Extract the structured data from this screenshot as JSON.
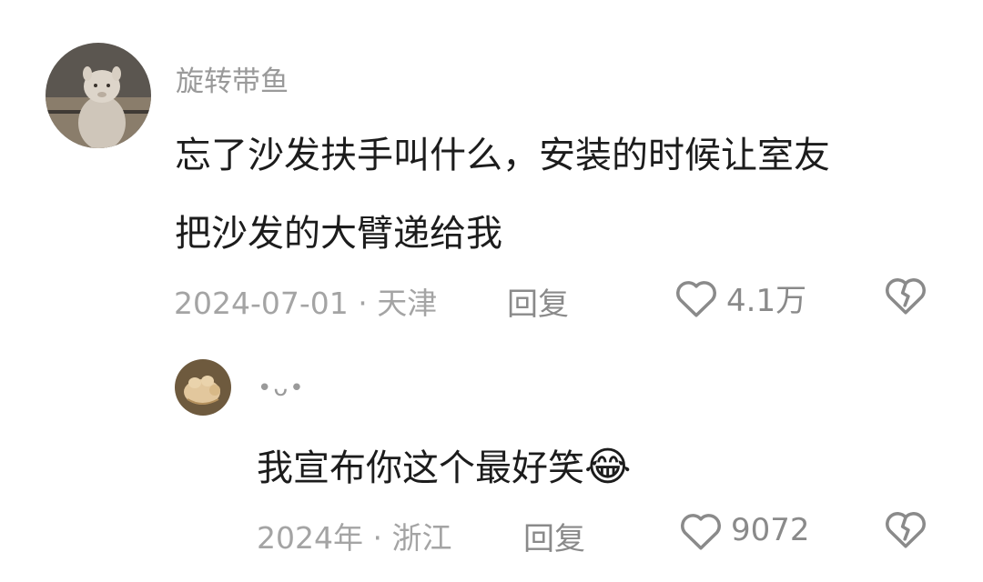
{
  "comment": {
    "username": "旋转带鱼",
    "text_line1": "忘了沙发扶手叫什么，安装的时候让室友",
    "text_line2": "把沙发的大臂递给我",
    "meta": "2024-07-01 · 天津",
    "reply_label": "回复",
    "like_count": "4.1万"
  },
  "reply": {
    "username": "•ᴗ•",
    "text": "我宣布你这个最好笑",
    "emoji": "😂",
    "meta": "2024年 · 浙江",
    "reply_label": "回复",
    "like_count": "9072"
  },
  "icons": {
    "like": "heart-outline-icon",
    "dislike": "broken-heart-icon"
  },
  "colors": {
    "text": "#1c1c1c",
    "muted": "#9a9a9a",
    "icon": "#8a8a8a"
  }
}
